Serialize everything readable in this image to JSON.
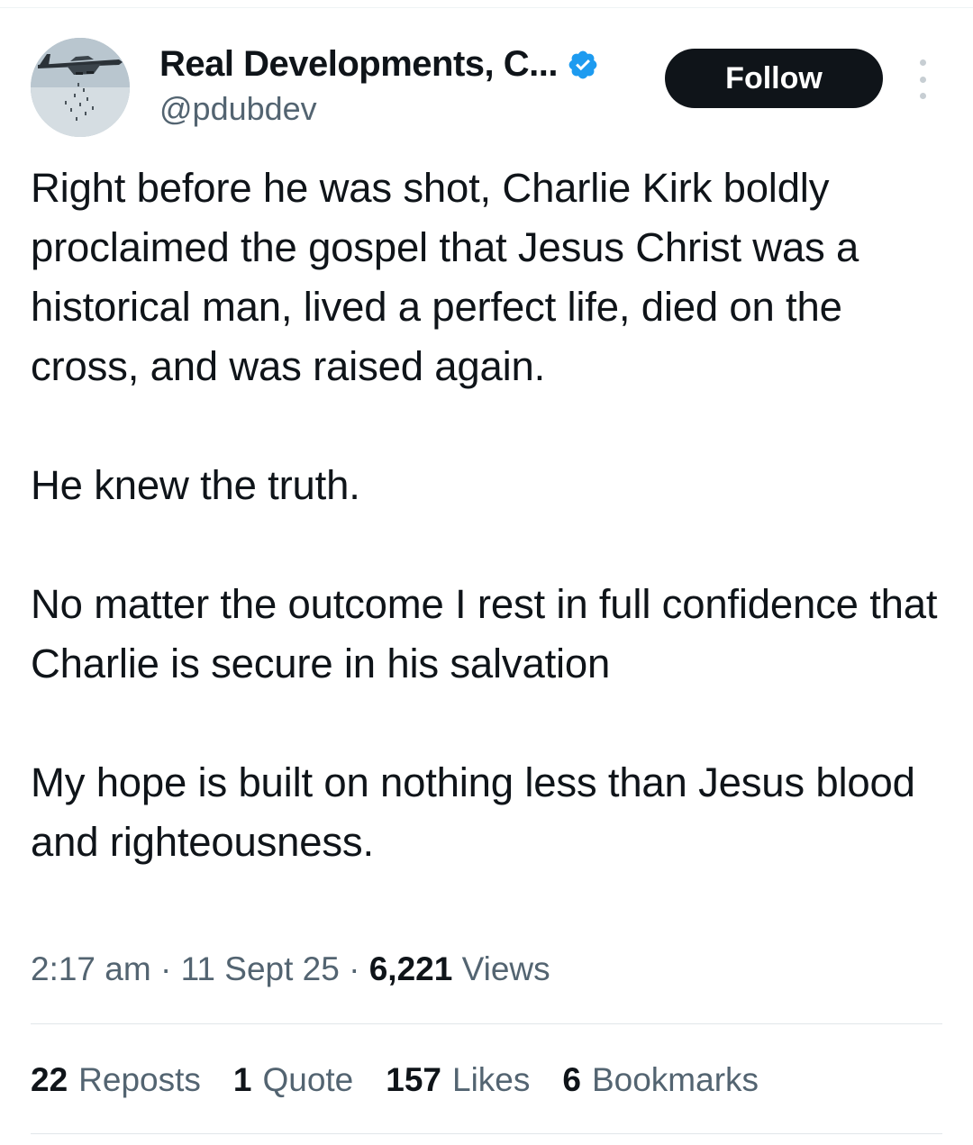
{
  "author": {
    "display_name": "Real Developments, C...",
    "handle": "@pdubdev",
    "verified": true,
    "avatar_icon": "bomber-aircraft-avatar",
    "verified_icon": "verified-badge-icon"
  },
  "actions": {
    "follow_label": "Follow",
    "more_icon": "more-vertical-icon"
  },
  "tweet": {
    "paragraphs": [
      "Right before he was shot, Charlie Kirk boldly proclaimed the gospel that Jesus Christ was a historical man, lived a perfect life, died on the cross, and was raised again.",
      "He knew the truth.",
      "No matter the outcome I rest in full confidence that Charlie is secure in his salvation",
      "My hope is built on nothing less than Jesus blood and righteousness."
    ]
  },
  "meta": {
    "time": "2:17 am",
    "sep1": "·",
    "date": "11 Sept 25",
    "sep2": "·",
    "views_count": "6,221",
    "views_label": "Views"
  },
  "stats": [
    {
      "count": "22",
      "label": "Reposts"
    },
    {
      "count": "1",
      "label": "Quote"
    },
    {
      "count": "157",
      "label": "Likes"
    },
    {
      "count": "6",
      "label": "Bookmarks"
    }
  ],
  "colors": {
    "text": "#0f1419",
    "secondary": "#536471",
    "verified": "#1d9bf0",
    "button_bg": "#0f1419",
    "button_text": "#ffffff",
    "divider": "#e1e6e9"
  }
}
